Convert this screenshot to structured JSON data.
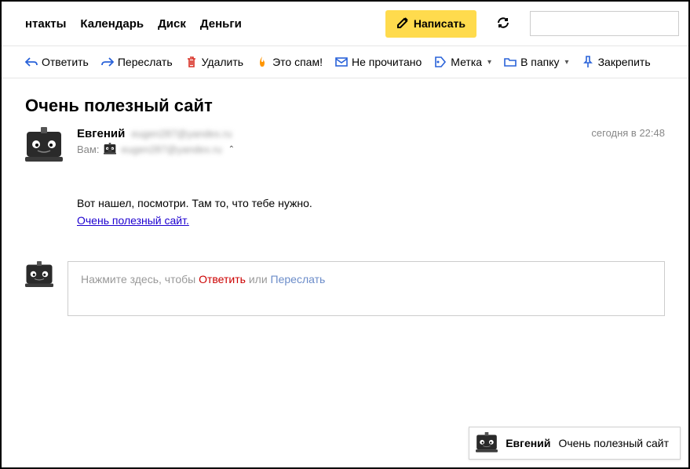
{
  "nav": {
    "contacts": "нтакты",
    "calendar": "Календарь",
    "disk": "Диск",
    "money": "Деньги"
  },
  "compose": {
    "label": "Написать"
  },
  "search": {
    "value": ""
  },
  "toolbar": {
    "reply": "Ответить",
    "forward": "Переслать",
    "delete": "Удалить",
    "spam": "Это спам!",
    "unread": "Не прочитано",
    "label": "Метка",
    "folder": "В папку",
    "pin": "Закрепить"
  },
  "email": {
    "subject": "Очень полезный сайт",
    "sender_name": "Евгений",
    "sender_email": "eugen287@yandex.ru",
    "to_label": "Вам:",
    "to_email": "eugen287@yandex.ru",
    "date": "сегодня в 22:48",
    "body_line1": "Вот нашел, посмотри. Там то, что тебе нужно.",
    "body_link": "Очень полезный сайт."
  },
  "reply_placeholder": {
    "prefix": "Нажмите здесь, чтобы ",
    "reply": "Ответить",
    "mid": " или ",
    "forward": "Переслать"
  },
  "chip": {
    "name": "Евгений",
    "subject": "Очень полезный сайт"
  },
  "colors": {
    "accent": "#ffdb4d",
    "link": "#1d00cf",
    "danger": "#d93025",
    "spam": "#ff9500"
  }
}
